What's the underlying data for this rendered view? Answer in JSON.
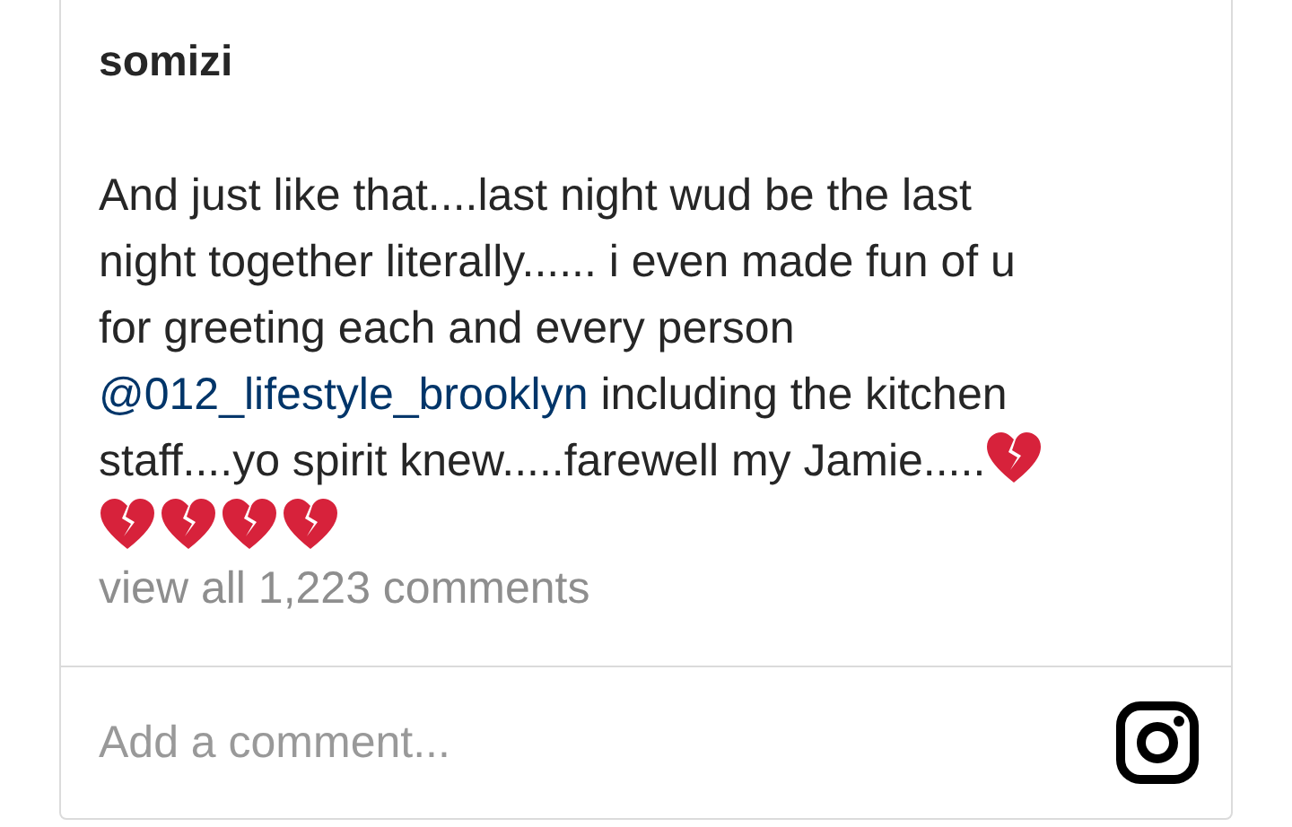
{
  "post": {
    "username": "somizi",
    "caption": [
      {
        "kind": "text",
        "text": "And just like that....last night wud be the last\nnight together literally...... i even made fun of u\nfor greeting each and every person\n"
      },
      {
        "kind": "mention",
        "text": "@012_lifestyle_brooklyn"
      },
      {
        "kind": "text",
        "text": " including the kitchen\nstaff....yo spirit knew.....farewell my Jamie....."
      }
    ],
    "comments_link": "view all 1,223 comments"
  },
  "comment_field": {
    "placeholder": "Add a comment..."
  }
}
